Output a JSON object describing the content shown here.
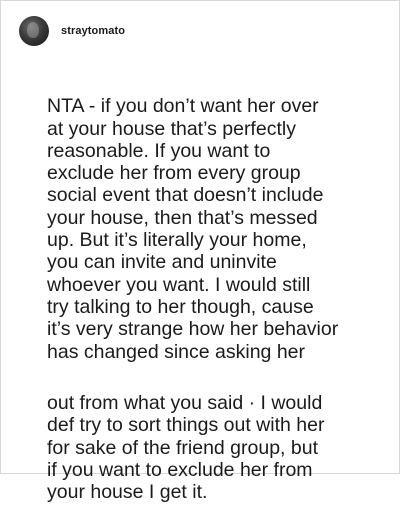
{
  "post": {
    "username": "straytomato",
    "paragraphs": [
      "NTA - if you don’t want her over\nat your house that’s perfectly\nreasonable. If you want to\nexclude her from every group\nsocial event that doesn’t include\nyour house, then that’s messed\nup. But it’s literally your home,\nyou can invite and uninvite\nwhoever you want. I would still\ntry talking to her though, cause\nit’s very strange how her behavior\nhas changed since asking her",
      "out from what you said · I would\ndef try to sort things out with her\nfor sake of the friend group, but\nif you want to exclude her from\nyour house I get it."
    ]
  }
}
